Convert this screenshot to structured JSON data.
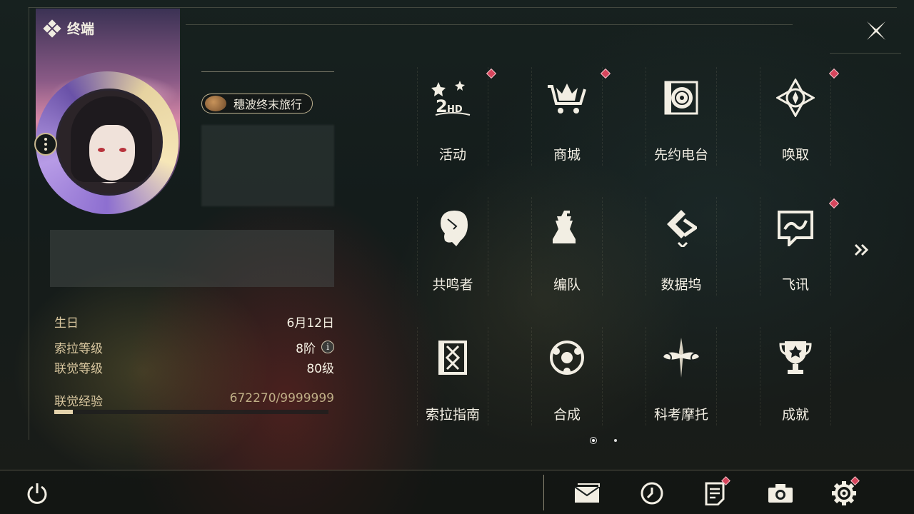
{
  "header": {
    "title": "终端"
  },
  "profile": {
    "title_badge": "穗波终末旅行",
    "stats": [
      {
        "label": "生日",
        "value": "6月12日"
      },
      {
        "label": "索拉等级",
        "value": "8阶",
        "info": true
      },
      {
        "label": "联觉等级",
        "value": "80级"
      }
    ],
    "exp": {
      "label": "联觉经验",
      "value": "672270/9999999",
      "fraction": 0.067
    }
  },
  "menu": [
    {
      "label": "活动",
      "icon": "event-2hd-icon",
      "badge": true
    },
    {
      "label": "商城",
      "icon": "shop-cart-icon",
      "badge": true
    },
    {
      "label": "先约电台",
      "icon": "radio-record-icon",
      "badge": false
    },
    {
      "label": "唤取",
      "icon": "compass-summon-icon",
      "badge": true
    },
    {
      "label": "共鸣者",
      "icon": "resonator-head-icon",
      "badge": false
    },
    {
      "label": "编队",
      "icon": "chess-team-icon",
      "badge": false
    },
    {
      "label": "数据坞",
      "icon": "data-dock-icon",
      "badge": false
    },
    {
      "label": "飞讯",
      "icon": "chat-message-icon",
      "badge": true
    },
    {
      "label": "索拉指南",
      "icon": "guide-book-icon",
      "badge": false
    },
    {
      "label": "合成",
      "icon": "synthesis-orbit-icon",
      "badge": false
    },
    {
      "label": "科考摩托",
      "icon": "motorcycle-icon",
      "badge": false
    },
    {
      "label": "成就",
      "icon": "trophy-icon",
      "badge": false
    }
  ],
  "pager": {
    "current": 1,
    "total": 2
  },
  "colors": {
    "badge": "#d7455c",
    "accent_gold": "#d9c79f",
    "text": "#f2eee3"
  }
}
